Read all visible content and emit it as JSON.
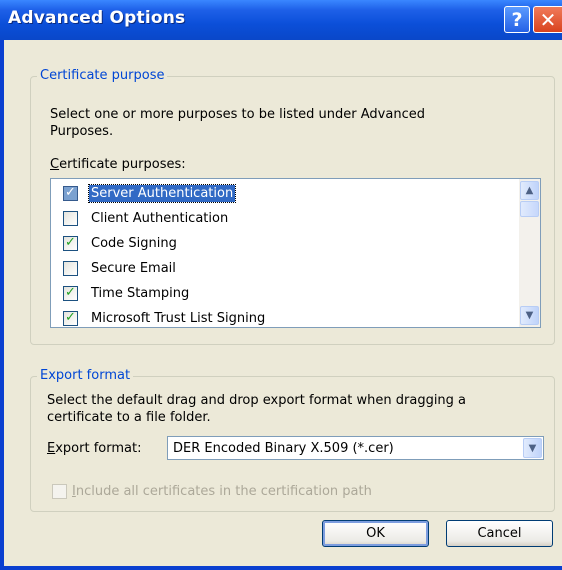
{
  "window": {
    "title": "Advanced Options",
    "help_glyph": "?",
    "close_glyph": "✕"
  },
  "purpose_group": {
    "legend": "Certificate purpose",
    "description_line1": "Select one or more purposes to be listed under Advanced",
    "description_line2": "Purposes.",
    "list_label_mnemonic": "C",
    "list_label_rest": "ertificate purposes:",
    "items": [
      {
        "label": "Server Authentication",
        "checked": true,
        "selected": true
      },
      {
        "label": "Client Authentication",
        "checked": false,
        "selected": false
      },
      {
        "label": "Code Signing",
        "checked": true,
        "selected": false
      },
      {
        "label": "Secure Email",
        "checked": false,
        "selected": false
      },
      {
        "label": "Time Stamping",
        "checked": true,
        "selected": false
      },
      {
        "label": "Microsoft Trust List Signing",
        "checked": true,
        "selected": false
      }
    ]
  },
  "export_group": {
    "legend": "Export format",
    "description_line1": "Select the default drag and drop export format when dragging a",
    "description_line2": "certificate to a file folder.",
    "format_label_mnemonic": "E",
    "format_label_rest": "xport format:",
    "format_value": "DER Encoded Binary X.509 (*.cer)",
    "include_mnemonic": "I",
    "include_rest": "nclude all certificates in the certification path",
    "include_checked": false
  },
  "buttons": {
    "ok": "OK",
    "cancel": "Cancel"
  },
  "icons": {
    "check": "✓",
    "arrow_up": "▲",
    "arrow_down": "▼"
  }
}
